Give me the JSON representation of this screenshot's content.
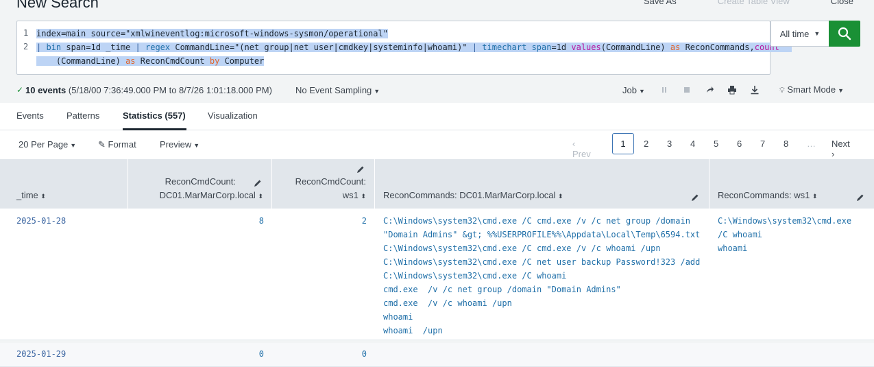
{
  "page": {
    "title": "New Search",
    "actions": {
      "save_as": "Save As",
      "create_table_view": "Create Table View",
      "close": "Close"
    }
  },
  "search": {
    "line_numbers": [
      "1",
      "2"
    ],
    "line1": "index=main source=\"xmlwineventlog:microsoft-windows-sysmon/operational\"",
    "line2_parts": {
      "pipe1": "|",
      "bin": "bin",
      "bin_args": " span=1d _time ",
      "pipe2": "|",
      "regex": "regex",
      "regex_args": " CommandLine=\"(net group|net user|cmdkey|systeminfo|whoami)\" ",
      "pipe3": "|",
      "timechart": "timechart",
      "span_kw": "span",
      "span_val": "=1d ",
      "values_fn": "values",
      "values_args": "(CommandLine) ",
      "as1": "as",
      "recon_commands": " ReconCommands,",
      "count_fn": "count"
    },
    "line3_parts": {
      "count_args": "(CommandLine) ",
      "as2": "as",
      "recon_count": " ReconCmdCount ",
      "by": "by",
      "computer": " Computer"
    },
    "time_range": "All time"
  },
  "status": {
    "event_count": "10 events",
    "range": "(5/18/00 7:36:49.000 PM to 8/7/26 1:01:18.000 PM)",
    "sampling": "No Event Sampling",
    "job": "Job",
    "mode": "Smart Mode"
  },
  "tabs": [
    {
      "label": "Events"
    },
    {
      "label": "Patterns"
    },
    {
      "label": "Statistics (557)"
    },
    {
      "label": "Visualization"
    }
  ],
  "toolbar": {
    "per_page": "20 Per Page",
    "format": "Format",
    "preview": "Preview"
  },
  "pagination": {
    "prev": "‹ Prev",
    "pages": [
      "1",
      "2",
      "3",
      "4",
      "5",
      "6",
      "7",
      "8"
    ],
    "ellipsis": "…",
    "next": "Next ›",
    "current": "1"
  },
  "table": {
    "columns": [
      {
        "label": "_time"
      },
      {
        "label_l1": "ReconCmdCount:",
        "label_l2": "DC01.MarMarCorp.local"
      },
      {
        "label_l1": "ReconCmdCount:",
        "label_l2": "ws1"
      },
      {
        "label": "ReconCommands: DC01.MarMarCorp.local"
      },
      {
        "label": "ReconCommands: ws1"
      }
    ],
    "rows": [
      {
        "time": "2025-01-28",
        "count_dc01": "8",
        "count_ws1": "2",
        "cmds_dc01": [
          "C:\\Windows\\system32\\cmd.exe /C cmd.exe /v /c net group /domain",
          "\"Domain Admins\" &gt; %%USERPROFILE%%\\Appdata\\Local\\Temp\\6594.txt",
          "C:\\Windows\\system32\\cmd.exe /C cmd.exe /v /c whoami /upn",
          "C:\\Windows\\system32\\cmd.exe /C net user backup Password!323 /add",
          "C:\\Windows\\system32\\cmd.exe /C whoami",
          "cmd.exe  /v /c net group /domain \"Domain Admins\"",
          "cmd.exe  /v /c whoami /upn",
          "whoami",
          "whoami  /upn"
        ],
        "cmds_ws1": [
          "C:\\Windows\\system32\\cmd.exe",
          "/C whoami",
          "whoami"
        ]
      },
      {
        "time": "2025-01-29",
        "count_dc01": "0",
        "count_ws1": "0",
        "cmds_dc01": [],
        "cmds_ws1": []
      }
    ]
  },
  "colors": {
    "search_button": "#1a9035",
    "selection": "#bdd4f5",
    "header_bg": "#e1e6eb",
    "link": "#1f6fa8"
  }
}
